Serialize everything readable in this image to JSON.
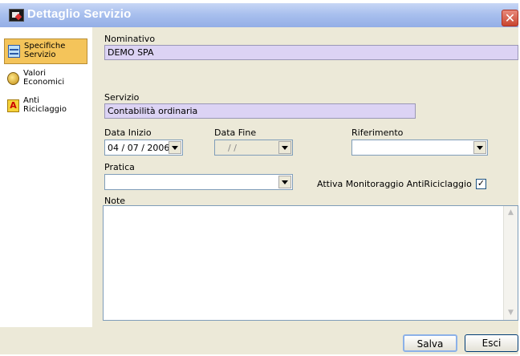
{
  "window": {
    "title": "Dettaglio Servizio",
    "close_glyph": "✕"
  },
  "sidebar": {
    "items": [
      {
        "label_line1": "Specifiche",
        "label_line2": "Servizio",
        "icon": "document-list-icon",
        "active": true
      },
      {
        "label_line1": "Valori",
        "label_line2": "Economici",
        "icon": "money-bag-icon",
        "active": false
      },
      {
        "label_line1": "Anti",
        "label_line2": "Riciclaggio",
        "icon": "anti-money-laundering-icon",
        "active": false
      }
    ]
  },
  "form": {
    "nominativo": {
      "label": "Nominativo",
      "value": "DEMO SPA"
    },
    "servizio": {
      "label": "Servizio",
      "value": "Contabilità ordinaria"
    },
    "data_inizio": {
      "label": "Data Inizio",
      "value": "04 / 07 / 2006"
    },
    "data_fine": {
      "label": "Data Fine",
      "value": " /  / "
    },
    "riferimento": {
      "label": "Riferimento",
      "value": ""
    },
    "pratica": {
      "label": "Pratica",
      "value": ""
    },
    "monitoraggio": {
      "label": "Attiva Monitoraggio AntiRiciclaggio",
      "checked": true,
      "check_glyph": "✓"
    },
    "note": {
      "label": "Note",
      "value": ""
    }
  },
  "buttons": {
    "save": "Salva",
    "exit": "Esci"
  },
  "colors": {
    "accent_title": "#a9c0ee",
    "active_item": "#f4c45a",
    "readonly_field": "#dcd3f4"
  }
}
